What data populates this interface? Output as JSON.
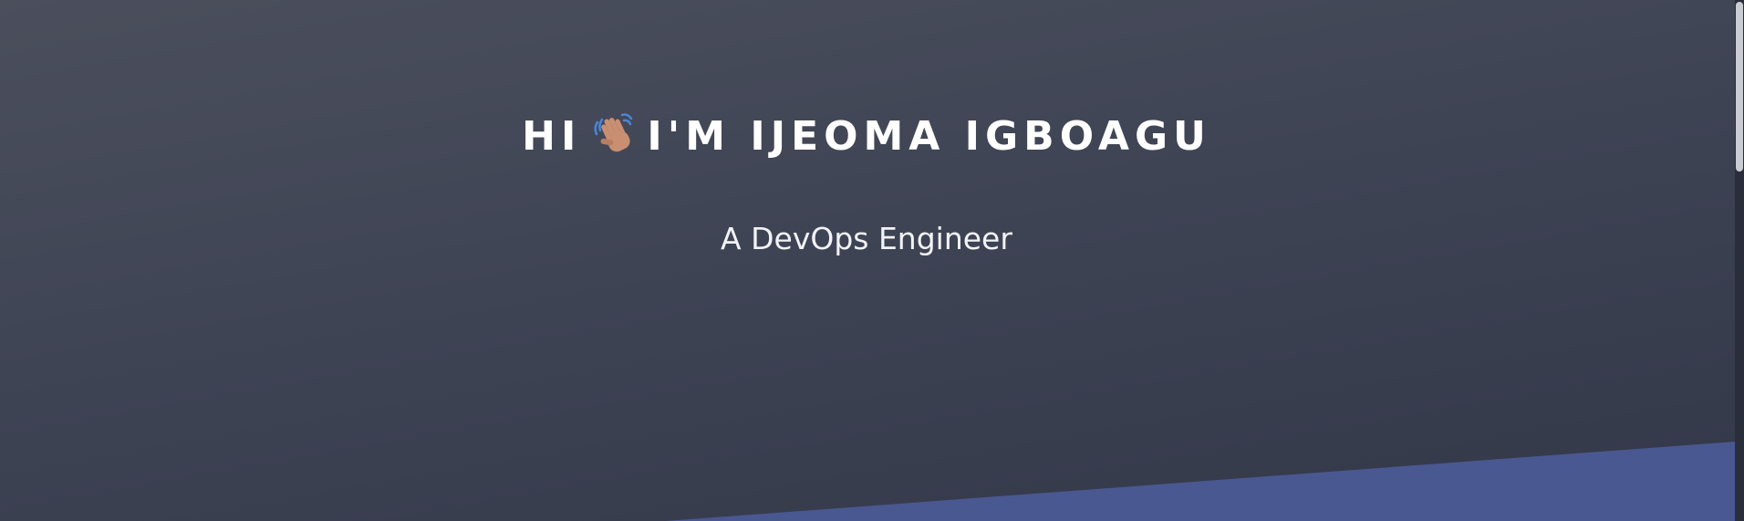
{
  "hero": {
    "greeting": "HI",
    "wave_icon": "waving-hand-emoji-icon",
    "name_line": "I'M IJEOMA IGBOAGU",
    "subtitle": "A DevOps Engineer"
  },
  "colors": {
    "background_top": "#4b4f5c",
    "background_bottom": "#333849",
    "divider_band": "#4a5891",
    "text": "#ffffff"
  }
}
